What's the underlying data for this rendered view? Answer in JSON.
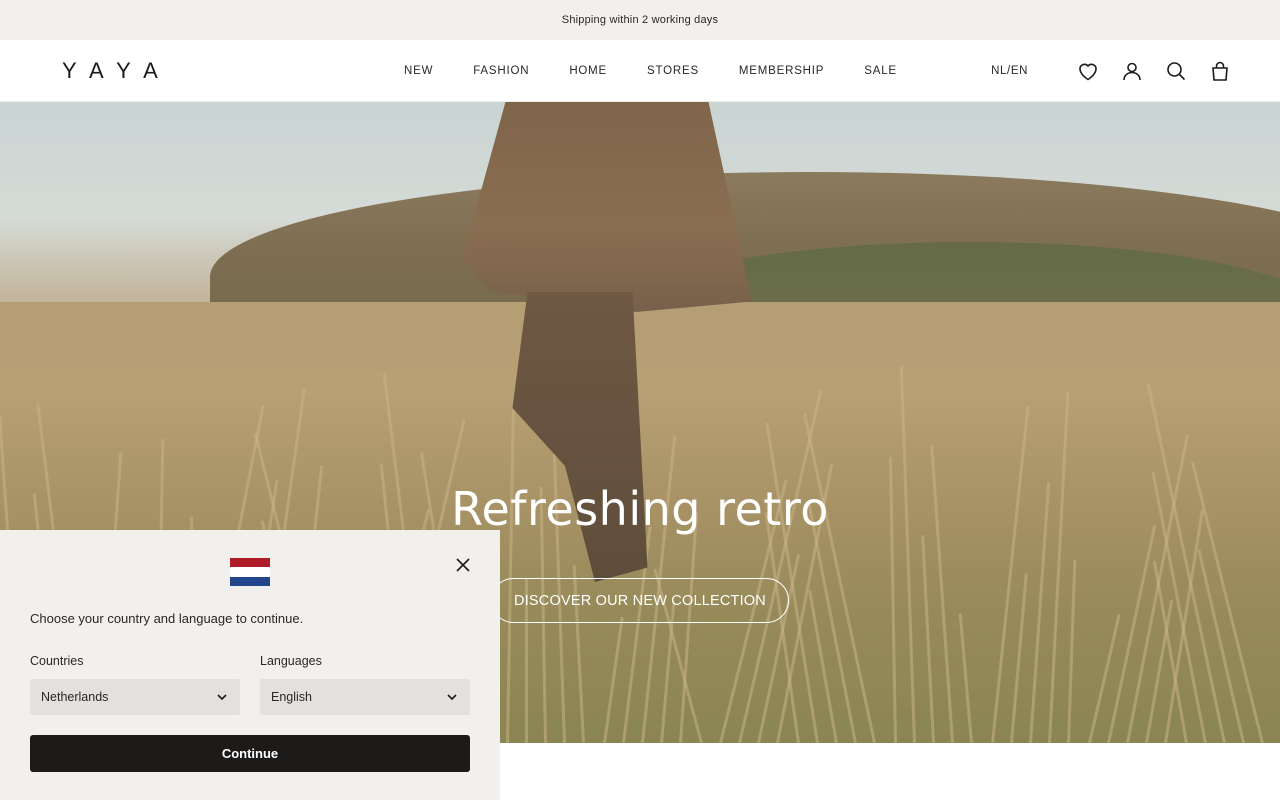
{
  "announcement": {
    "text": "Shipping within 2 working days"
  },
  "header": {
    "logo": "YAYA",
    "nav": [
      "NEW",
      "FASHION",
      "HOME",
      "STORES",
      "MEMBERSHIP",
      "SALE"
    ],
    "locale": "NL/EN",
    "icons": [
      "heart-icon",
      "account-icon",
      "search-icon",
      "bag-icon"
    ]
  },
  "hero": {
    "title": "Refreshing retro",
    "cta": "DISCOVER OUR NEW COLLECTION"
  },
  "popup": {
    "flag_colors": [
      "#ae1c28",
      "#ffffff",
      "#21468b"
    ],
    "text": "Choose your country and language to continue.",
    "countries_label": "Countries",
    "country_value": "Netherlands",
    "languages_label": "Languages",
    "language_value": "English",
    "continue_label": "Continue"
  },
  "colors": {
    "announcement_bg": "#f1f0ec",
    "button_dark": "#1d1b19",
    "select_bg": "#e3e1dd"
  }
}
